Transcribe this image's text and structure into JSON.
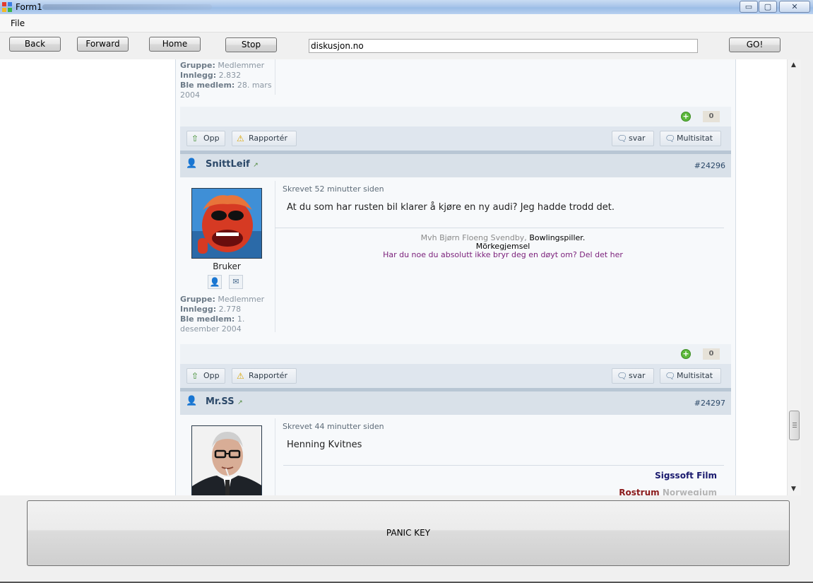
{
  "window": {
    "title": "Form1",
    "controls": {
      "minimize": "▭",
      "maximize": "▢",
      "close": "✕"
    }
  },
  "menu": {
    "file": "File"
  },
  "toolbar": {
    "back": "Back",
    "forward": "Forward",
    "home": "Home",
    "stop": "Stop",
    "address": "diskusjon.no",
    "go": "GO!"
  },
  "post_prev": {
    "group_label": "Gruppe:",
    "group": "Medlemmer",
    "posts_label": "Innlegg:",
    "posts": "2.832",
    "joined_label": "Ble medlem:",
    "joined": "28. mars 2004",
    "rep_count": "0"
  },
  "actions": {
    "up": "Opp",
    "report": "Rapportér",
    "reply": "svar",
    "multiquote": "Multisitat"
  },
  "post1": {
    "username": "SnittLeif",
    "post_number": "#24296",
    "posted": "Skrevet 52 minutter siden",
    "text": "At du som har rusten bil klarer å kjøre en ny audi? Jeg hadde trodd det.",
    "role": "Bruker",
    "group_label": "Gruppe:",
    "group": "Medlemmer",
    "posts_label": "Innlegg:",
    "posts": "2.778",
    "joined_label": "Ble medlem:",
    "joined": "1. desember 2004",
    "sig_line1_prefix": "Mvh Bjørn Floeng Svendby,",
    "sig_line1_link": "Bowlingspiller.",
    "sig_line2": "Mörkegjemsel",
    "sig_line3": "Har du noe du absolutt ikke bryr deg en døyt om? Del det her",
    "rep_count": "0"
  },
  "post2": {
    "username": "Mr.SS",
    "post_number": "#24297",
    "posted": "Skrevet 44 minutter siden",
    "text": "Henning Kvitnes",
    "sig_line1": "Sigssoft Film",
    "sig_line2a": "Rostrum",
    "sig_line2b": "Norwegium"
  },
  "panic": {
    "label": "PANIC KEY"
  },
  "colors": {
    "link": "#2b4868",
    "signature_purple": "#7a1f7a",
    "sig_navy": "#1a1a6e",
    "sig_red": "#8b1a1a"
  }
}
